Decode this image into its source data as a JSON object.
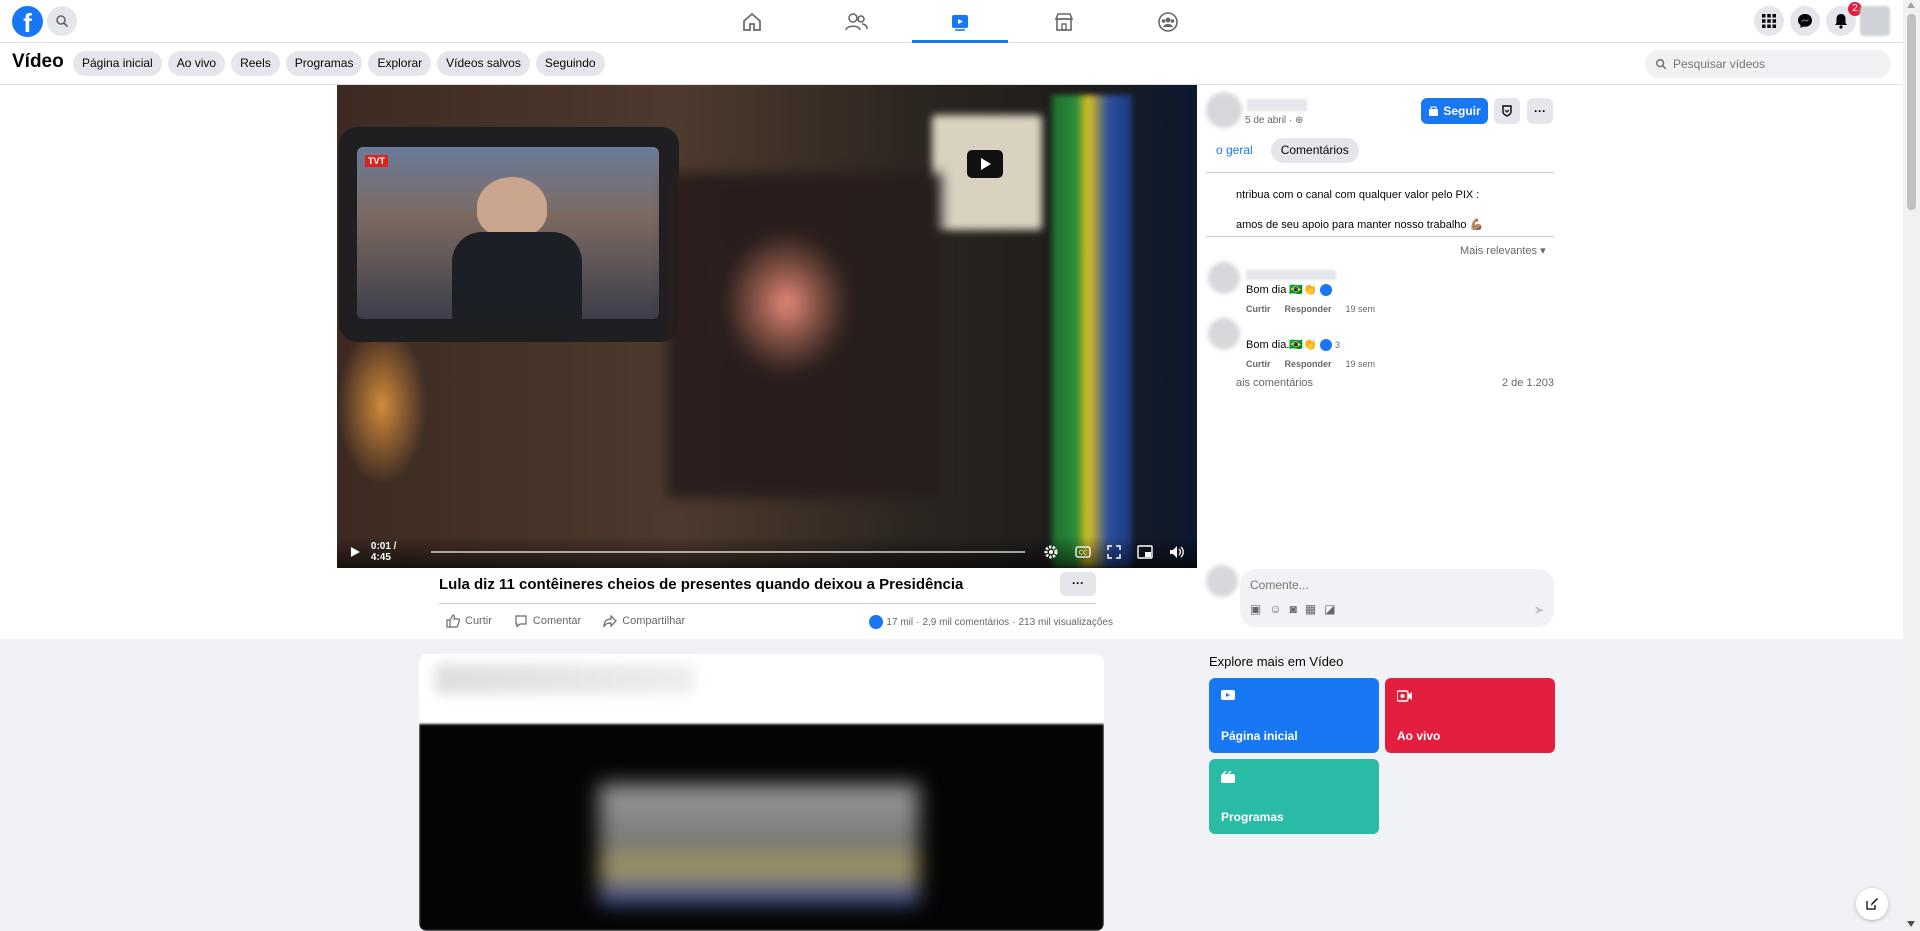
{
  "header": {
    "logo_letter": "f",
    "nav_icons": [
      "home-icon",
      "friends-icon",
      "watch-icon",
      "marketplace-icon",
      "groups-icon"
    ],
    "active_nav": "watch-icon",
    "notifications_badge": "2"
  },
  "subnav": {
    "title": "Vídeo",
    "pills": [
      "Página inicial",
      "Ao vivo",
      "Reels",
      "Programas",
      "Explorar",
      "Vídeos salvos",
      "Seguindo"
    ],
    "search_placeholder": "Pesquisar vídeos"
  },
  "video": {
    "time": "0:01 / 4:45",
    "overlay_tag": "TVT",
    "progress_fraction": 0.004
  },
  "post": {
    "title": "Lula diz 11 contêineres cheios de presentes quando deixou a Presidência",
    "more": "···",
    "actions": [
      "Curtir",
      "Comentar",
      "Compartilhar"
    ],
    "likes": "17 mil",
    "comments": "2,9 mil comentários",
    "views": "213 mil visualizações",
    "stats_sep": "·"
  },
  "right_panel": {
    "date": "5 de abril ·",
    "follow_label": "Seguir",
    "more": "···",
    "tabs": [
      "o geral",
      "Comentários"
    ],
    "description_lines": [
      "ntribua com o canal com qualquer valor pelo PIX :",
      "amos de seu apoio para manter nosso trabalho 💪🏽"
    ],
    "sort_label": "Mais relevantes",
    "comments": [
      {
        "text": "Bom dia 🇧🇷👏",
        "like": "Curtir",
        "reply": "Responder",
        "time": "19 sem",
        "reactions": ""
      },
      {
        "text": "Bom dia.🇧🇷👏",
        "like": "Curtir",
        "reply": "Responder",
        "time": "19 sem",
        "reactions": "3"
      }
    ],
    "more_comments": "ais comentários",
    "count": "2 de 1.203",
    "comment_placeholder": "Comente..."
  },
  "explore": {
    "title": "Explore mais em Vídeo",
    "tiles": [
      {
        "label": "Página inicial",
        "color": "#1877f2"
      },
      {
        "label": "Ao vivo",
        "color": "#e41e3f"
      },
      {
        "label": "Programas",
        "color": "#2abba7"
      }
    ]
  }
}
